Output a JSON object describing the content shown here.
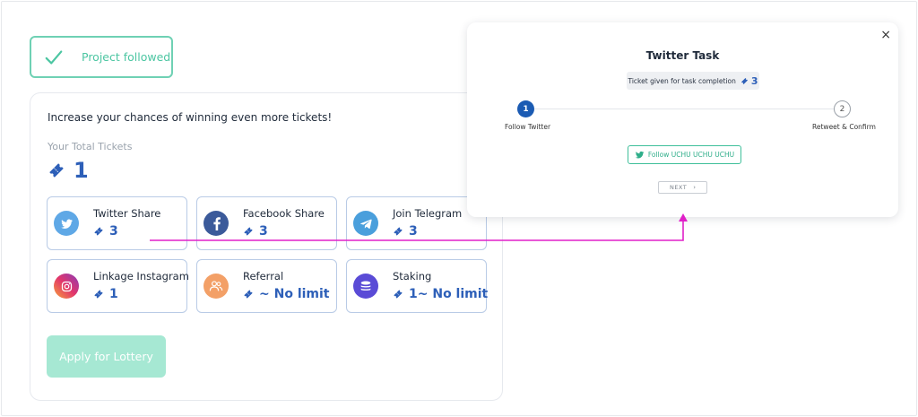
{
  "followed_badge": {
    "label": "Project followed",
    "color": "#4cc6a2"
  },
  "card": {
    "headline": "Increase your chances of winning even more tickets!",
    "total_label": "Your Total Tickets",
    "total_value": "1",
    "tasks": [
      {
        "name": "Twitter Share",
        "reward": "3",
        "icon": "twitter-icon"
      },
      {
        "name": "Facebook Share",
        "reward": "3",
        "icon": "facebook-icon"
      },
      {
        "name": "Join Telegram",
        "reward": "3",
        "icon": "telegram-icon"
      },
      {
        "name": "Linkage Instagram",
        "reward": "1",
        "icon": "instagram-icon"
      },
      {
        "name": "Referral",
        "reward": "~ No limit",
        "icon": "referral-icon"
      },
      {
        "name": "Staking",
        "reward": "1~ No limit",
        "icon": "staking-icon"
      }
    ],
    "apply_label": "Apply for Lottery"
  },
  "modal": {
    "close": "×",
    "title": "Twitter Task",
    "pill_label": "Ticket given for task completion",
    "pill_value": "3",
    "steps": [
      {
        "number": "1",
        "label": "Follow Twitter"
      },
      {
        "number": "2",
        "label": "Retweet & Confirm"
      }
    ],
    "follow_label": "Follow UCHU UCHU UCHU",
    "next_label": "NEXT",
    "next_chevron": "›"
  },
  "colors": {
    "accent_blue": "#2d5fb8",
    "accent_green": "#4cc6a2",
    "arrow_magenta": "#e020c8"
  }
}
